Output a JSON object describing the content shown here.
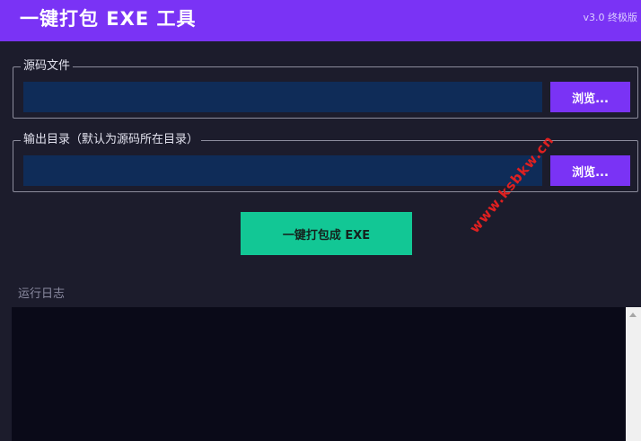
{
  "header": {
    "title": "一键打包 EXE 工具",
    "version": "v3.0 终极版"
  },
  "source_group": {
    "legend": "源码文件",
    "value": "",
    "browse_label": "浏览..."
  },
  "output_group": {
    "legend": "输出目录（默认为源码所在目录）",
    "value": "",
    "browse_label": "浏览..."
  },
  "build_button": {
    "label": "一键打包成 EXE"
  },
  "log": {
    "label": "运行日志",
    "content": ""
  },
  "watermark": {
    "text": "www.ksbkw.cn"
  },
  "colors": {
    "accent": "#7a33f5",
    "background": "#1c1c2c",
    "input_bg": "#0f2c58",
    "build_button": "#12c795",
    "log_bg": "#0a0a18"
  }
}
